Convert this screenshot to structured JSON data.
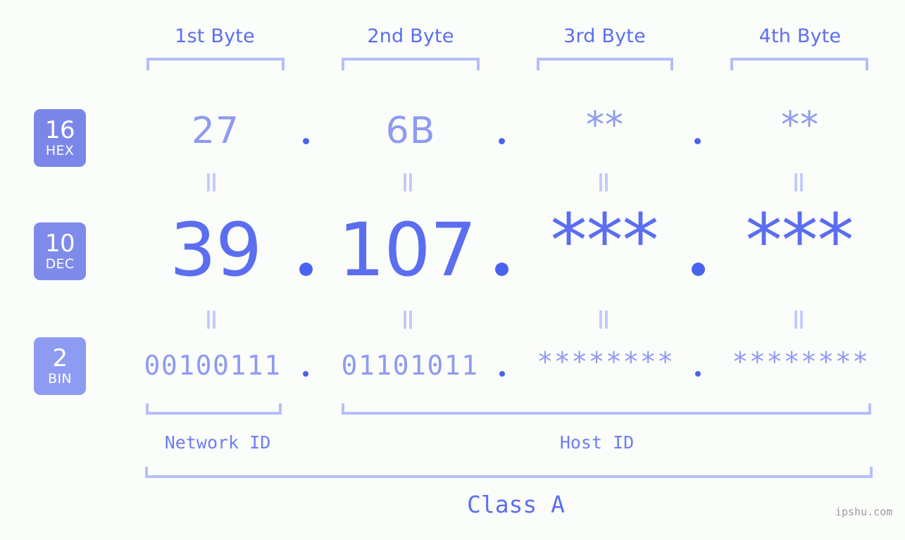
{
  "background": "#fbfdfa",
  "accent": "#5b6ef0",
  "accent_light": "#8e9bf0",
  "bracket_color": "#b5bffa",
  "byte_headers": [
    {
      "label": "1st Byte"
    },
    {
      "label": "2nd Byte"
    },
    {
      "label": "3rd Byte"
    },
    {
      "label": "4th Byte"
    }
  ],
  "rows": [
    {
      "badge_number": "16",
      "badge_name": "HEX",
      "badge_color": "#7b87e8",
      "values": [
        "27",
        "6B",
        "**",
        "**"
      ],
      "separator": "."
    },
    {
      "badge_number": "10",
      "badge_name": "DEC",
      "badge_color": "#7f8bea",
      "values": [
        "39",
        "107",
        "***",
        "***"
      ],
      "separator": "."
    },
    {
      "badge_number": "2",
      "badge_name": "BIN",
      "badge_color": "#8e9bf2",
      "values": [
        "00100111",
        "01101011",
        "********",
        "********"
      ],
      "separator": "."
    }
  ],
  "equals_symbol": "=",
  "segments": [
    {
      "label": "Network ID"
    },
    {
      "label": "Host ID"
    }
  ],
  "class_label": "Class A",
  "watermark": "ipshu.com"
}
